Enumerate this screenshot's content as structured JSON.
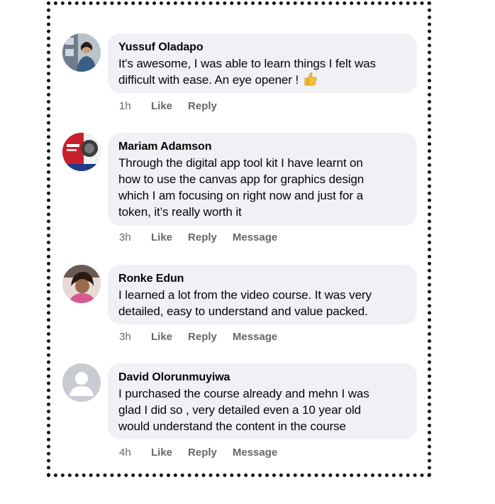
{
  "comments": [
    {
      "name": "Yussuf Oladapo",
      "text_lines": [
        "It's awesome, I was able to learn things I felt was",
        "difficult with ease. An eye opener ! "
      ],
      "emoji": "thumbs-up",
      "time": "1h",
      "like": "Like",
      "reply": "Reply"
    },
    {
      "name": "Mariam Adamson",
      "text_lines": [
        "Through the digital app tool kit I have learnt on",
        "how to use the canvas app for graphics design",
        "which I am focusing on right now and just for a",
        "token, it’s really worth it"
      ],
      "time": "3h",
      "like": "Like",
      "reply": "Reply",
      "message": "Message"
    },
    {
      "name": "Ronke Edun",
      "text_lines": [
        "I learned a lot from the video course. It was very",
        "detailed, easy to understand and value packed."
      ],
      "time": "3h",
      "like": "Like",
      "reply": "Reply",
      "message": "Message"
    },
    {
      "name": "David Olorunmuyiwa",
      "text_lines": [
        "I purchased the course already and mehn I was",
        "glad I did so , very detailed even a 10 year old",
        "would understand the content in the course"
      ],
      "time": "4h",
      "like": "Like",
      "reply": "Reply",
      "message": "Message"
    }
  ],
  "colors": {
    "bubble": "#eff1f4",
    "meta_text": "#65676b",
    "frame": "#111111"
  }
}
